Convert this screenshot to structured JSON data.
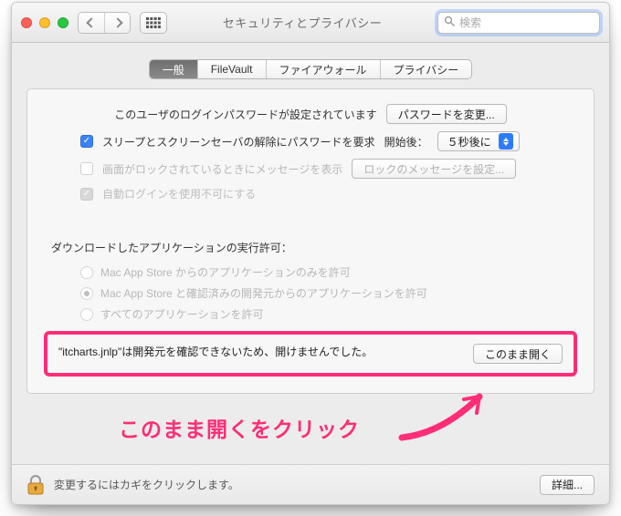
{
  "window": {
    "title": "セキュリティとプライバシー"
  },
  "search": {
    "placeholder": "検索"
  },
  "tabs": {
    "general": "一般",
    "filevault": "FileVault",
    "firewall": "ファイアウォール",
    "privacy": "プライバシー"
  },
  "login": {
    "password_set_label": "このユーザのログインパスワードが設定されています",
    "change_password_btn": "パスワードを変更..."
  },
  "screensaver": {
    "require_label": "スリープとスクリーンセーバの解除にパスワードを要求",
    "after_label": "開始後：",
    "delay_value": "５秒後に"
  },
  "lockmsg": {
    "show_label": "画面がロックされているときにメッセージを表示",
    "set_btn": "ロックのメッセージを設定..."
  },
  "autologin": {
    "disable_label": "自動ログインを使用不可にする"
  },
  "gatekeeper": {
    "section_title": "ダウンロードしたアプリケーションの実行許可：",
    "opt_appstore": "Mac App Store からのアプリケーションのみを許可",
    "opt_identified": "Mac App Store と確認済みの開発元からのアプリケーションを許可",
    "opt_anywhere": "すべてのアプリケーションを許可",
    "blocked_msg": "\"itcharts.jnlp\"は開発元を確認できないため、開けませんでした。",
    "open_anyway_btn": "このまま開く"
  },
  "footer": {
    "lock_text": "変更するにはカギをクリックします。",
    "advanced_btn": "詳細..."
  },
  "annotation": {
    "text": "このまま開くをクリック"
  }
}
